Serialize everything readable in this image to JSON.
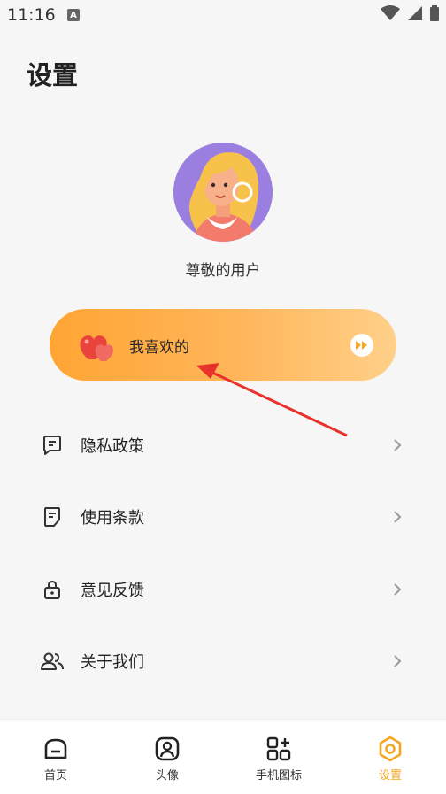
{
  "status_bar": {
    "time": "11:16",
    "notification_glyph": "A"
  },
  "header": {
    "title": "设置"
  },
  "profile": {
    "username": "尊敬的用户"
  },
  "favorites": {
    "label": "我喜欢的"
  },
  "menu": [
    {
      "label": "隐私政策",
      "icon": "document-icon"
    },
    {
      "label": "使用条款",
      "icon": "terms-icon"
    },
    {
      "label": "意见反馈",
      "icon": "lock-icon"
    },
    {
      "label": "关于我们",
      "icon": "users-icon"
    }
  ],
  "bottom_nav": [
    {
      "label": "首页",
      "icon": "home-icon"
    },
    {
      "label": "头像",
      "icon": "avatar-icon"
    },
    {
      "label": "手机图标",
      "icon": "apps-icon"
    },
    {
      "label": "设置",
      "icon": "settings-icon",
      "active": true
    }
  ],
  "colors": {
    "accent": "#f5a623",
    "card_start": "#ffa534",
    "card_end": "#ffd089",
    "annotation": "#e8322b"
  }
}
